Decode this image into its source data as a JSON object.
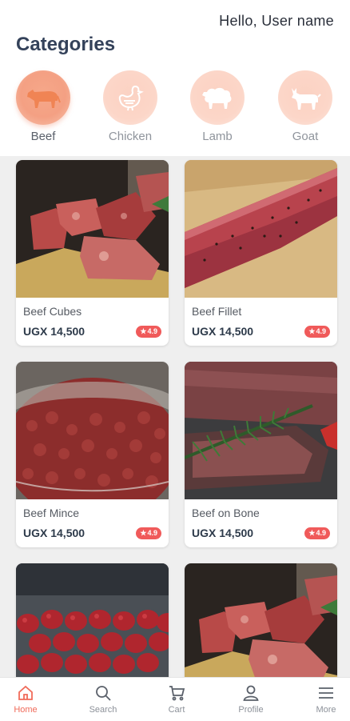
{
  "header": {
    "greeting": "Hello, User name",
    "title": "Categories"
  },
  "categories": [
    {
      "label": "Beef",
      "icon": "cow-icon",
      "active": true
    },
    {
      "label": "Chicken",
      "icon": "chicken-icon",
      "active": false
    },
    {
      "label": "Lamb",
      "icon": "sheep-icon",
      "active": false
    },
    {
      "label": "Goat",
      "icon": "goat-icon",
      "active": false
    }
  ],
  "products": [
    {
      "name": "Beef Cubes",
      "price": "UGX 14,500",
      "rating": "4.9",
      "image": "beef-cubes-photo"
    },
    {
      "name": "Beef Fillet",
      "price": "UGX 14,500",
      "rating": "4.9",
      "image": "beef-fillet-photo"
    },
    {
      "name": "Beef Mince",
      "price": "UGX 14,500",
      "rating": "4.9",
      "image": "beef-mince-photo"
    },
    {
      "name": "Beef on Bone",
      "price": "UGX 14,500",
      "rating": "4.9",
      "image": "beef-on-bone-photo"
    },
    {
      "name": "",
      "price": "",
      "rating": "",
      "image": "sausages-photo"
    },
    {
      "name": "",
      "price": "",
      "rating": "",
      "image": "beef-cubes-photo"
    }
  ],
  "nav": [
    {
      "label": "Home",
      "icon": "home-icon",
      "active": true
    },
    {
      "label": "Search",
      "icon": "search-icon",
      "active": false
    },
    {
      "label": "Cart",
      "icon": "cart-icon",
      "active": false
    },
    {
      "label": "Profile",
      "icon": "profile-icon",
      "active": false
    },
    {
      "label": "More",
      "icon": "menu-icon",
      "active": false
    }
  ],
  "colors": {
    "accent": "#f06b5a",
    "category_circle": "#f4a083",
    "badge": "#f05a5a",
    "title": "#34425a"
  }
}
